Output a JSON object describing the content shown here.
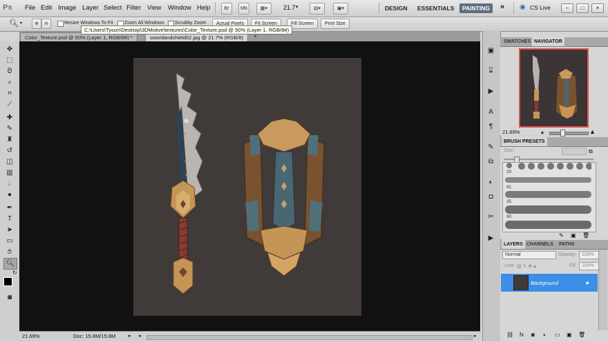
{
  "menu": {
    "logo": "Ps",
    "items": [
      "File",
      "Edit",
      "Image",
      "Layer",
      "Select",
      "Filter",
      "View",
      "Window",
      "Help"
    ],
    "bridge_label": "Br",
    "minibridge_label": "Mb",
    "zoom_value": "21.7",
    "workspaces": [
      "DESIGN",
      "ESSENTIALS",
      "PAINTING"
    ],
    "more": "»",
    "cs_live": "CS Live",
    "window_controls": [
      "–",
      "□",
      "×"
    ]
  },
  "options": {
    "resize_label": "Resize Windows To Fit",
    "zoom_all_label": "Zoom All Windows",
    "scrubby_label": "Scrubby Zoom",
    "actual_pixels": "Actual Pixels",
    "fit_screen": "Fit Screen",
    "fill_screen": "Fill Screen",
    "print_size": "Print Size",
    "tooltip": "C:\\Users\\Tyson\\Desktop\\3DMotive\\textures\\Color_Texture.psd @ 50% (Layer 1, RGB/8#)"
  },
  "tabs": [
    {
      "label": "Color_Texture.psd @ 50% (Layer 1, RGB/8#) *",
      "active": false
    },
    {
      "label": "swordandshield02.jpg @ 21.7% (RGB/8)",
      "active": true
    }
  ],
  "status": {
    "zoom": "21.69%",
    "doc": "Doc: 15.8M/15.8M"
  },
  "navigator": {
    "tabs": [
      "SWATCHES",
      "NAVIGATOR"
    ],
    "zoom": "21.69%"
  },
  "brush_presets": {
    "title": "BRUSH PRESETS",
    "size_label": "Size:",
    "numbers": [
      "20",
      "91",
      "35",
      "90"
    ]
  },
  "layers": {
    "tabs": [
      "LAYERS",
      "CHANNELS",
      "PATHS"
    ],
    "blend_mode": "Normal",
    "opacity_label": "Opacity:",
    "opacity_value": "100%",
    "lock_label": "Lock:",
    "fill_label": "Fill:",
    "fill_value": "100%",
    "layer_name": "Background"
  },
  "colors": {
    "canvas_bg": "#403a39",
    "workspace_bg": "#111111",
    "painting_active": "#5f6d80",
    "layer_selected": "#3d8ee6",
    "navigator_frame": "#e05050"
  }
}
